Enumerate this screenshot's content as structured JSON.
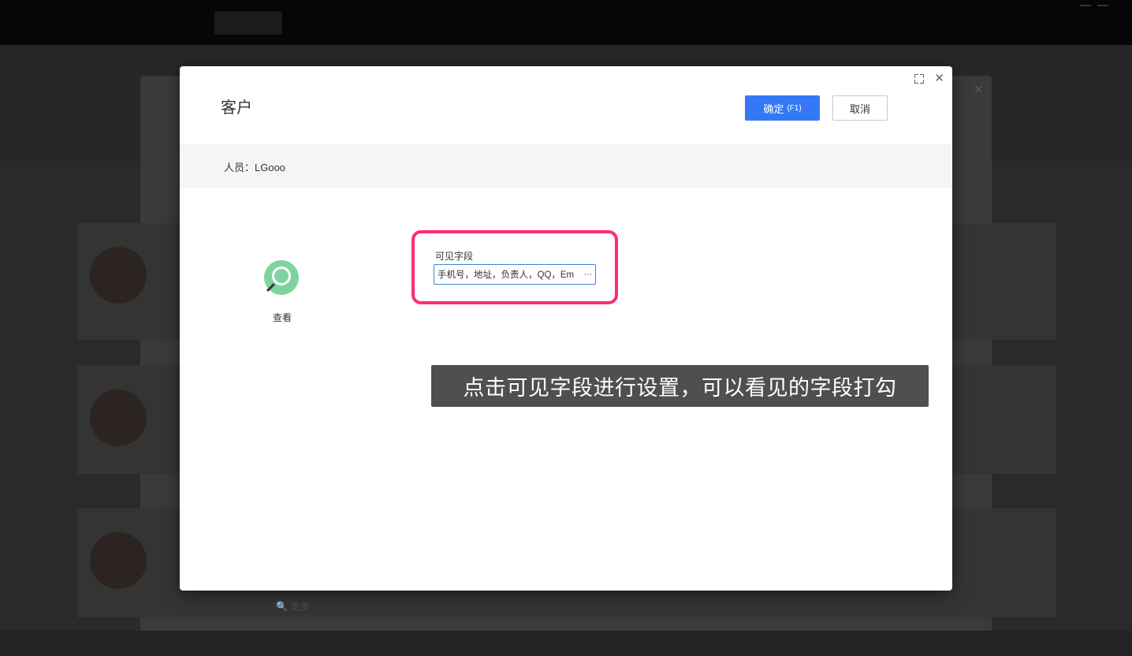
{
  "modal": {
    "title": "客户",
    "confirm_label": "确定",
    "confirm_key": "(F1)",
    "cancel_label": "取消",
    "person_label": "人员：LGooo",
    "view_label": "查看",
    "visible_fields_label": "可见字段",
    "visible_fields_value": "手机号，地址，负责人，QQ，Em",
    "more_icon": "···"
  },
  "background": {
    "more_label": "更多"
  },
  "caption": "点击可见字段进行设置，可以看见的字段打勾",
  "colors": {
    "primary": "#3478f6",
    "highlight": "#ff2d6f",
    "view_icon": "#7fd3a0"
  }
}
